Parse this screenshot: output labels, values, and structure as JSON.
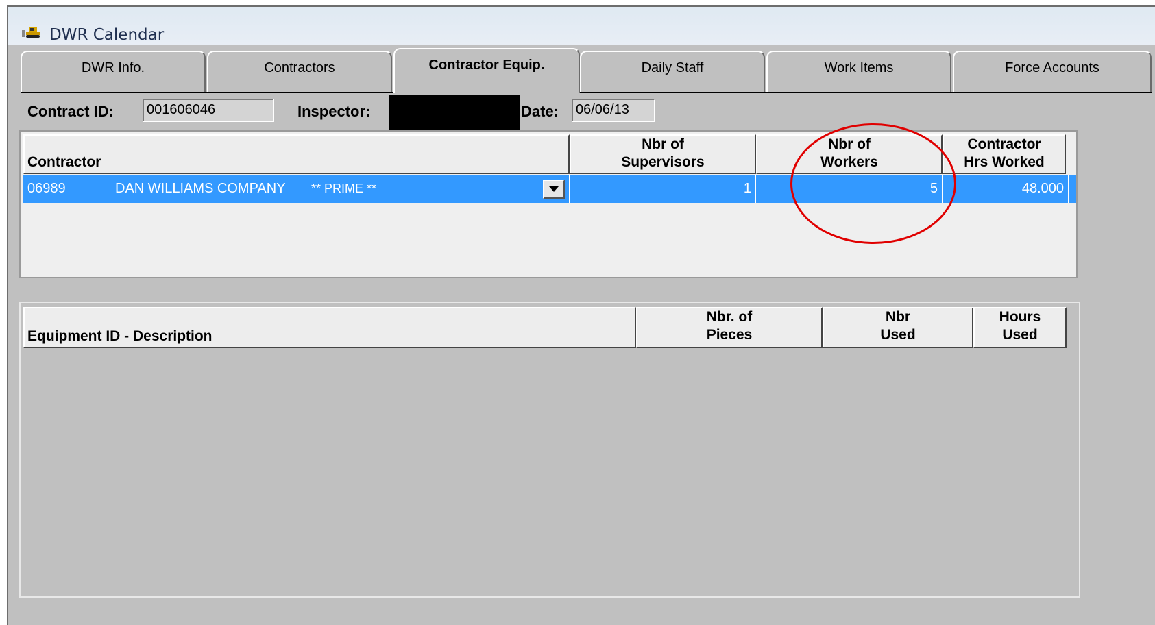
{
  "window": {
    "title": "DWR Calendar",
    "icon": "bulldozer-icon"
  },
  "tabs": [
    {
      "label": "DWR Info.",
      "active": false
    },
    {
      "label": "Contractors",
      "active": false
    },
    {
      "label": "Contractor Equip.",
      "active": true
    },
    {
      "label": "Daily Staff",
      "active": false
    },
    {
      "label": "Work Items",
      "active": false
    },
    {
      "label": "Force Accounts",
      "active": false
    }
  ],
  "header": {
    "contract_id_label": "Contract ID:",
    "contract_id_value": "001606046",
    "inspector_label": "Inspector:",
    "date_label": "Date:",
    "date_value": "06/06/13"
  },
  "contractor_grid": {
    "columns": {
      "contractor": "Contractor",
      "supervisors": [
        "Nbr of",
        "Supervisors"
      ],
      "workers": [
        "Nbr of",
        "Workers"
      ],
      "hrs": [
        "Contractor",
        "Hrs Worked"
      ]
    },
    "rows": [
      {
        "code": "06989",
        "name": "DAN WILLIAMS COMPANY",
        "tag": "** PRIME **",
        "supervisors": "1",
        "workers": "5",
        "hrs": "48.000"
      }
    ],
    "selection_color": "#3399ff"
  },
  "equipment_grid": {
    "columns": {
      "description": "Equipment ID - Description",
      "pieces": [
        "Nbr. of",
        "Pieces"
      ],
      "used": [
        "Nbr",
        "Used"
      ],
      "hours": [
        "Hours",
        "Used"
      ]
    },
    "rows": []
  },
  "annotation_color": "#e00000"
}
